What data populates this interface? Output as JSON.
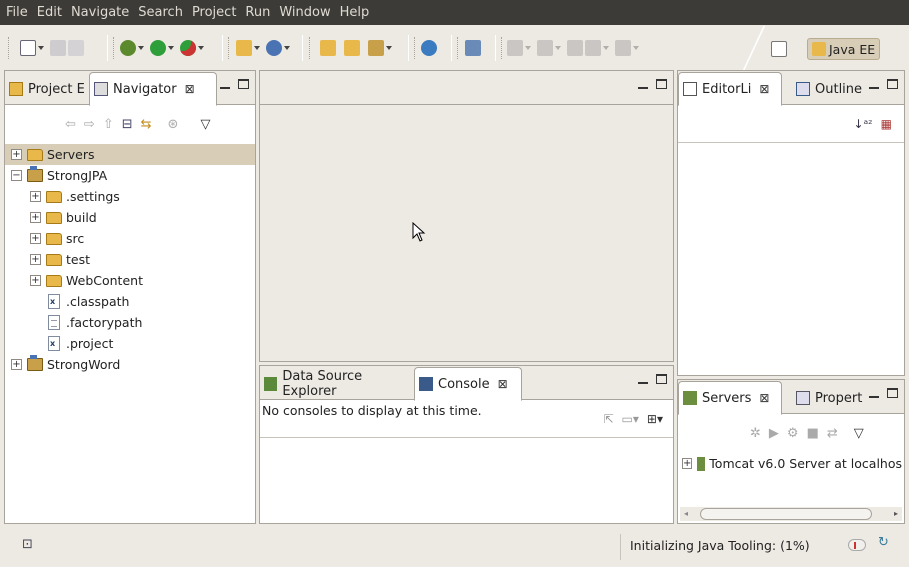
{
  "menu": [
    "File",
    "Edit",
    "Navigate",
    "Search",
    "Project",
    "Run",
    "Window",
    "Help"
  ],
  "perspective": {
    "label": "Java EE"
  },
  "left_panel": {
    "tabs": [
      {
        "label": "Project E"
      },
      {
        "label": "Navigator"
      }
    ],
    "tree": [
      {
        "label": "Servers",
        "kind": "folder",
        "expander": "+",
        "depth": 0,
        "selected": true
      },
      {
        "label": "StrongJPA",
        "kind": "project",
        "expander": "−",
        "depth": 0
      },
      {
        "label": ".settings",
        "kind": "folder",
        "expander": "+",
        "depth": 1
      },
      {
        "label": "build",
        "kind": "folder",
        "expander": "+",
        "depth": 1
      },
      {
        "label": "src",
        "kind": "folder",
        "expander": "+",
        "depth": 1
      },
      {
        "label": "test",
        "kind": "folder",
        "expander": "+",
        "depth": 1
      },
      {
        "label": "WebContent",
        "kind": "folder",
        "expander": "+",
        "depth": 1
      },
      {
        "label": ".classpath",
        "kind": "xfile",
        "expander": "",
        "depth": 1
      },
      {
        "label": ".factorypath",
        "kind": "tfile",
        "expander": "",
        "depth": 1
      },
      {
        "label": ".project",
        "kind": "xfile",
        "expander": "",
        "depth": 1
      },
      {
        "label": "StrongWord",
        "kind": "project",
        "expander": "+",
        "depth": 0
      }
    ]
  },
  "right_top_panel": {
    "tabs": [
      {
        "label": "EditorLi"
      },
      {
        "label": "Outline"
      }
    ]
  },
  "right_bottom_panel": {
    "tabs": [
      {
        "label": "Servers"
      },
      {
        "label": "Propert"
      }
    ],
    "server_item": "Tomcat v6.0 Server at localhos"
  },
  "bottom_panel": {
    "tabs": [
      {
        "label": "Data Source Explorer"
      },
      {
        "label": "Console"
      }
    ],
    "message": "No consoles to display at this time."
  },
  "status": {
    "text": "Initializing Java Tooling: (1%)"
  },
  "colors": {
    "menubar": "#3c3b37",
    "menu_text": "#dfdbd2",
    "chrome": "#ede9e3",
    "selection": "#d8cdb6"
  }
}
